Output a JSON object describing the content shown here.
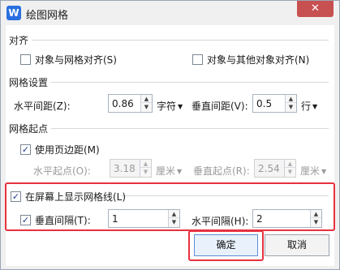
{
  "window": {
    "title": "绘图网格",
    "app_icon": "W",
    "close_glyph": "✕"
  },
  "align": {
    "title": "对齐",
    "snap_to_grid": {
      "label": "对象与网格对齐(S)",
      "checked": false
    },
    "snap_to_objects": {
      "label": "对象与其他对象对齐(N)",
      "checked": false
    }
  },
  "grid": {
    "title": "网格设置",
    "horizontal_label": "水平间距(Z):",
    "horizontal_value": "0.86",
    "horizontal_unit": "字符",
    "vertical_label": "垂直间距(V):",
    "vertical_value": "0.5",
    "vertical_unit": "行"
  },
  "origin": {
    "title": "网格起点",
    "use_margins": {
      "label": "使用页边距(M)",
      "checked": true
    },
    "h_origin_label": "水平起点(O):",
    "h_origin_value": "3.18",
    "h_origin_unit": "厘米",
    "v_origin_label": "垂直起点(R):",
    "v_origin_value": "2.54",
    "v_origin_unit": "厘米"
  },
  "display": {
    "show_gridlines": {
      "label": "在屏幕上显示网格线(L)",
      "checked": true
    },
    "vertical_interval": {
      "label": "垂直间隔(T):",
      "checked": true,
      "value": "1"
    },
    "horizontal_interval_label": "水平间隔(H):",
    "horizontal_interval_value": "2"
  },
  "buttons": {
    "ok": "确定",
    "cancel": "取消"
  },
  "colors": {
    "highlight": "#e8313f",
    "accent": "#2a6fe0"
  },
  "icons": {
    "check": "✓",
    "up": "▲",
    "down": "▼",
    "dropdown": "▼"
  }
}
